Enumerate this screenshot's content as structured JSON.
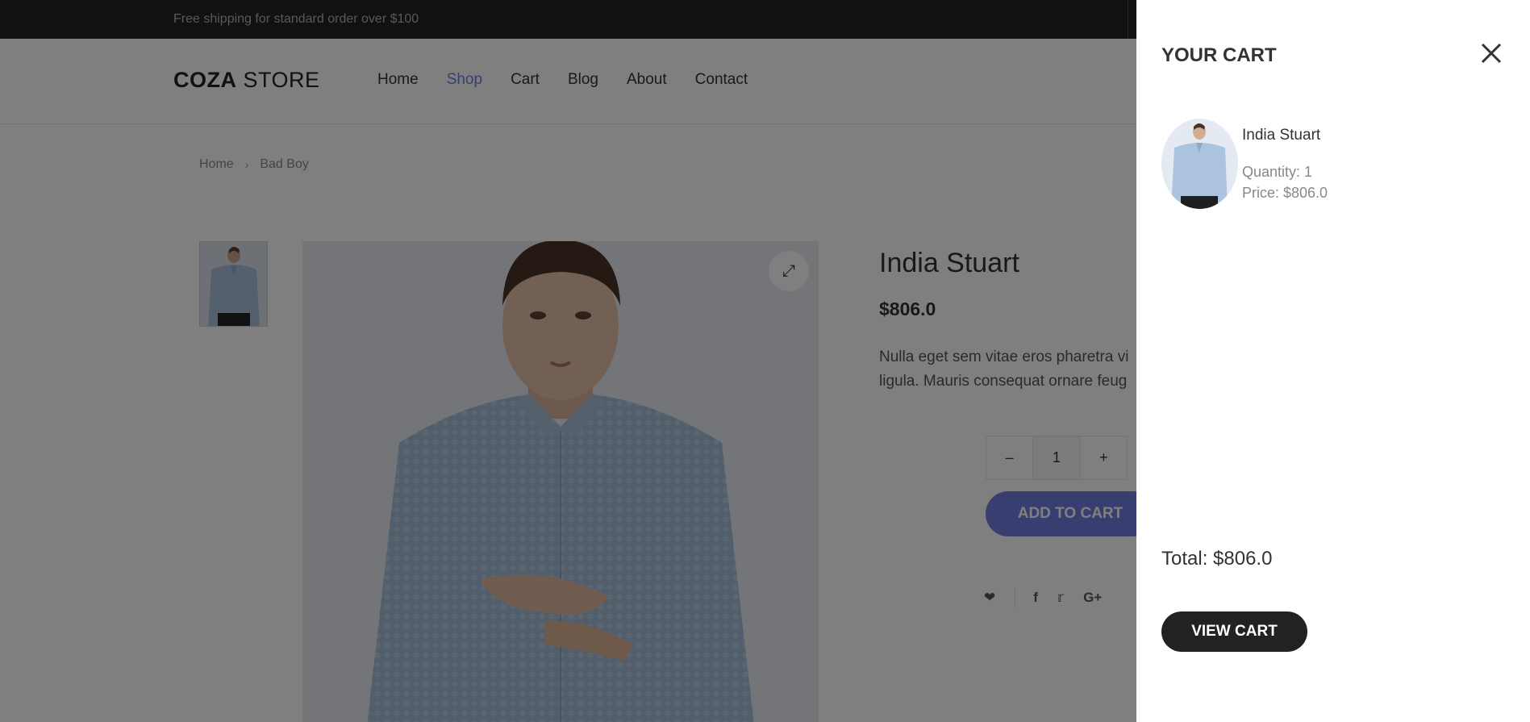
{
  "topbar": {
    "shipping_text": "Free shipping for standard order over $100"
  },
  "header": {
    "logo_bold": "COZA",
    "logo_light": " STORE",
    "nav": [
      "Home",
      "Shop",
      "Cart",
      "Blog",
      "About",
      "Contact"
    ],
    "active_nav": "Shop"
  },
  "breadcrumb": {
    "home": "Home",
    "current": "Bad Boy"
  },
  "product": {
    "title": "India Stuart",
    "price": "$806.0",
    "desc_line1": "Nulla eget sem vitae eros pharetra vi",
    "desc_line2": "ligula. Mauris consequat ornare feug",
    "quantity": "1",
    "add_to_cart": "ADD TO CART",
    "image_subject": "man in light blue gingham shirt"
  },
  "cart": {
    "title": "YOUR CART",
    "item_name": "India Stuart",
    "item_quantity": "Quantity: 1",
    "item_price": "Price: $806.0",
    "total": "Total: $806.0",
    "view_cart": "VIEW CART"
  },
  "colors": {
    "accent": "#717fe0",
    "topbar": "#222222",
    "button_dark": "#222222"
  },
  "icons": {
    "expand": "expand-icon",
    "minus": "minus-icon",
    "plus": "plus-icon",
    "heart": "heart-icon",
    "facebook": "facebook-icon",
    "twitter": "twitter-icon",
    "google_plus": "google-plus-icon",
    "close": "close-icon",
    "chevron": "chevron-right-icon"
  }
}
